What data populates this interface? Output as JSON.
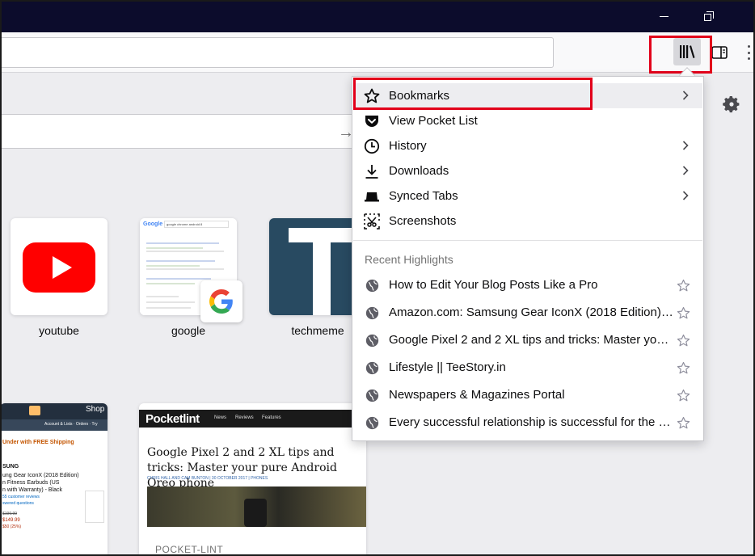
{
  "window": {
    "minimize_icon": "minimize-icon",
    "restore_icon": "restore-icon"
  },
  "toolbar": {
    "url_value": "",
    "library_icon": "library-icon",
    "sidebar_icon": "sidebar-icon",
    "overflow_icon": "overflow-menu-icon"
  },
  "newtab": {
    "search_value": "",
    "top_sites": [
      {
        "label": "youtube"
      },
      {
        "label": "google"
      },
      {
        "label": "techmeme"
      }
    ],
    "google_thumb": {
      "logo": "Google",
      "search_text": "google chrome android 8"
    },
    "amazon_card": {
      "header_right": "Shop",
      "nav": "Account & Lists · Orders · Try",
      "free_shipping": "Under with FREE Shipping",
      "brand": "SUNG",
      "product": "ung Gear IconX (2018 Edition)",
      "product2": "n Fitness Earbuds (US",
      "product3": "n with Warranty) - Black",
      "reviews": "55 customer reviews",
      "questions": "swered questions",
      "price_old": "$199.99",
      "price": "$149.99",
      "save": "$50 (25%)"
    },
    "pocket_card": {
      "logo": "Pocketlint",
      "nav": [
        "News",
        "Reviews",
        "Features"
      ],
      "title": "Google Pixel 2 and 2 XL tips and tricks: Master your pure Android Oreo phone",
      "byline": "CHRIS HALL AND CAM BUNTON | 30 OCTOBER 2017 | PHONES",
      "source": "POCKET-LINT"
    }
  },
  "library_panel": {
    "menu": [
      {
        "label": "Bookmarks",
        "icon": "star-icon",
        "has_submenu": true
      },
      {
        "label": "View Pocket List",
        "icon": "pocket-icon",
        "has_submenu": false
      },
      {
        "label": "History",
        "icon": "clock-icon",
        "has_submenu": true
      },
      {
        "label": "Downloads",
        "icon": "download-icon",
        "has_submenu": true
      },
      {
        "label": "Synced Tabs",
        "icon": "synced-tabs-icon",
        "has_submenu": true
      },
      {
        "label": "Screenshots",
        "icon": "screenshot-icon",
        "has_submenu": false
      }
    ],
    "recent_title": "Recent Highlights",
    "highlights": [
      {
        "label": "How to Edit Your Blog Posts Like a Pro"
      },
      {
        "label": "Amazon.com: Samsung Gear IconX (2018 Edition) C..."
      },
      {
        "label": "Google Pixel 2 and 2 XL tips and tricks: Master your ..."
      },
      {
        "label": "Lifestyle || TeeStory.in"
      },
      {
        "label": "Newspapers & Magazines Portal"
      },
      {
        "label": "Every successful relationship is successful for the sa..."
      }
    ]
  },
  "colors": {
    "highlight_box": "#e2001a",
    "titlebar": "#0c0c2c",
    "youtube": "#ff0000",
    "techmeme": "#284a61"
  }
}
